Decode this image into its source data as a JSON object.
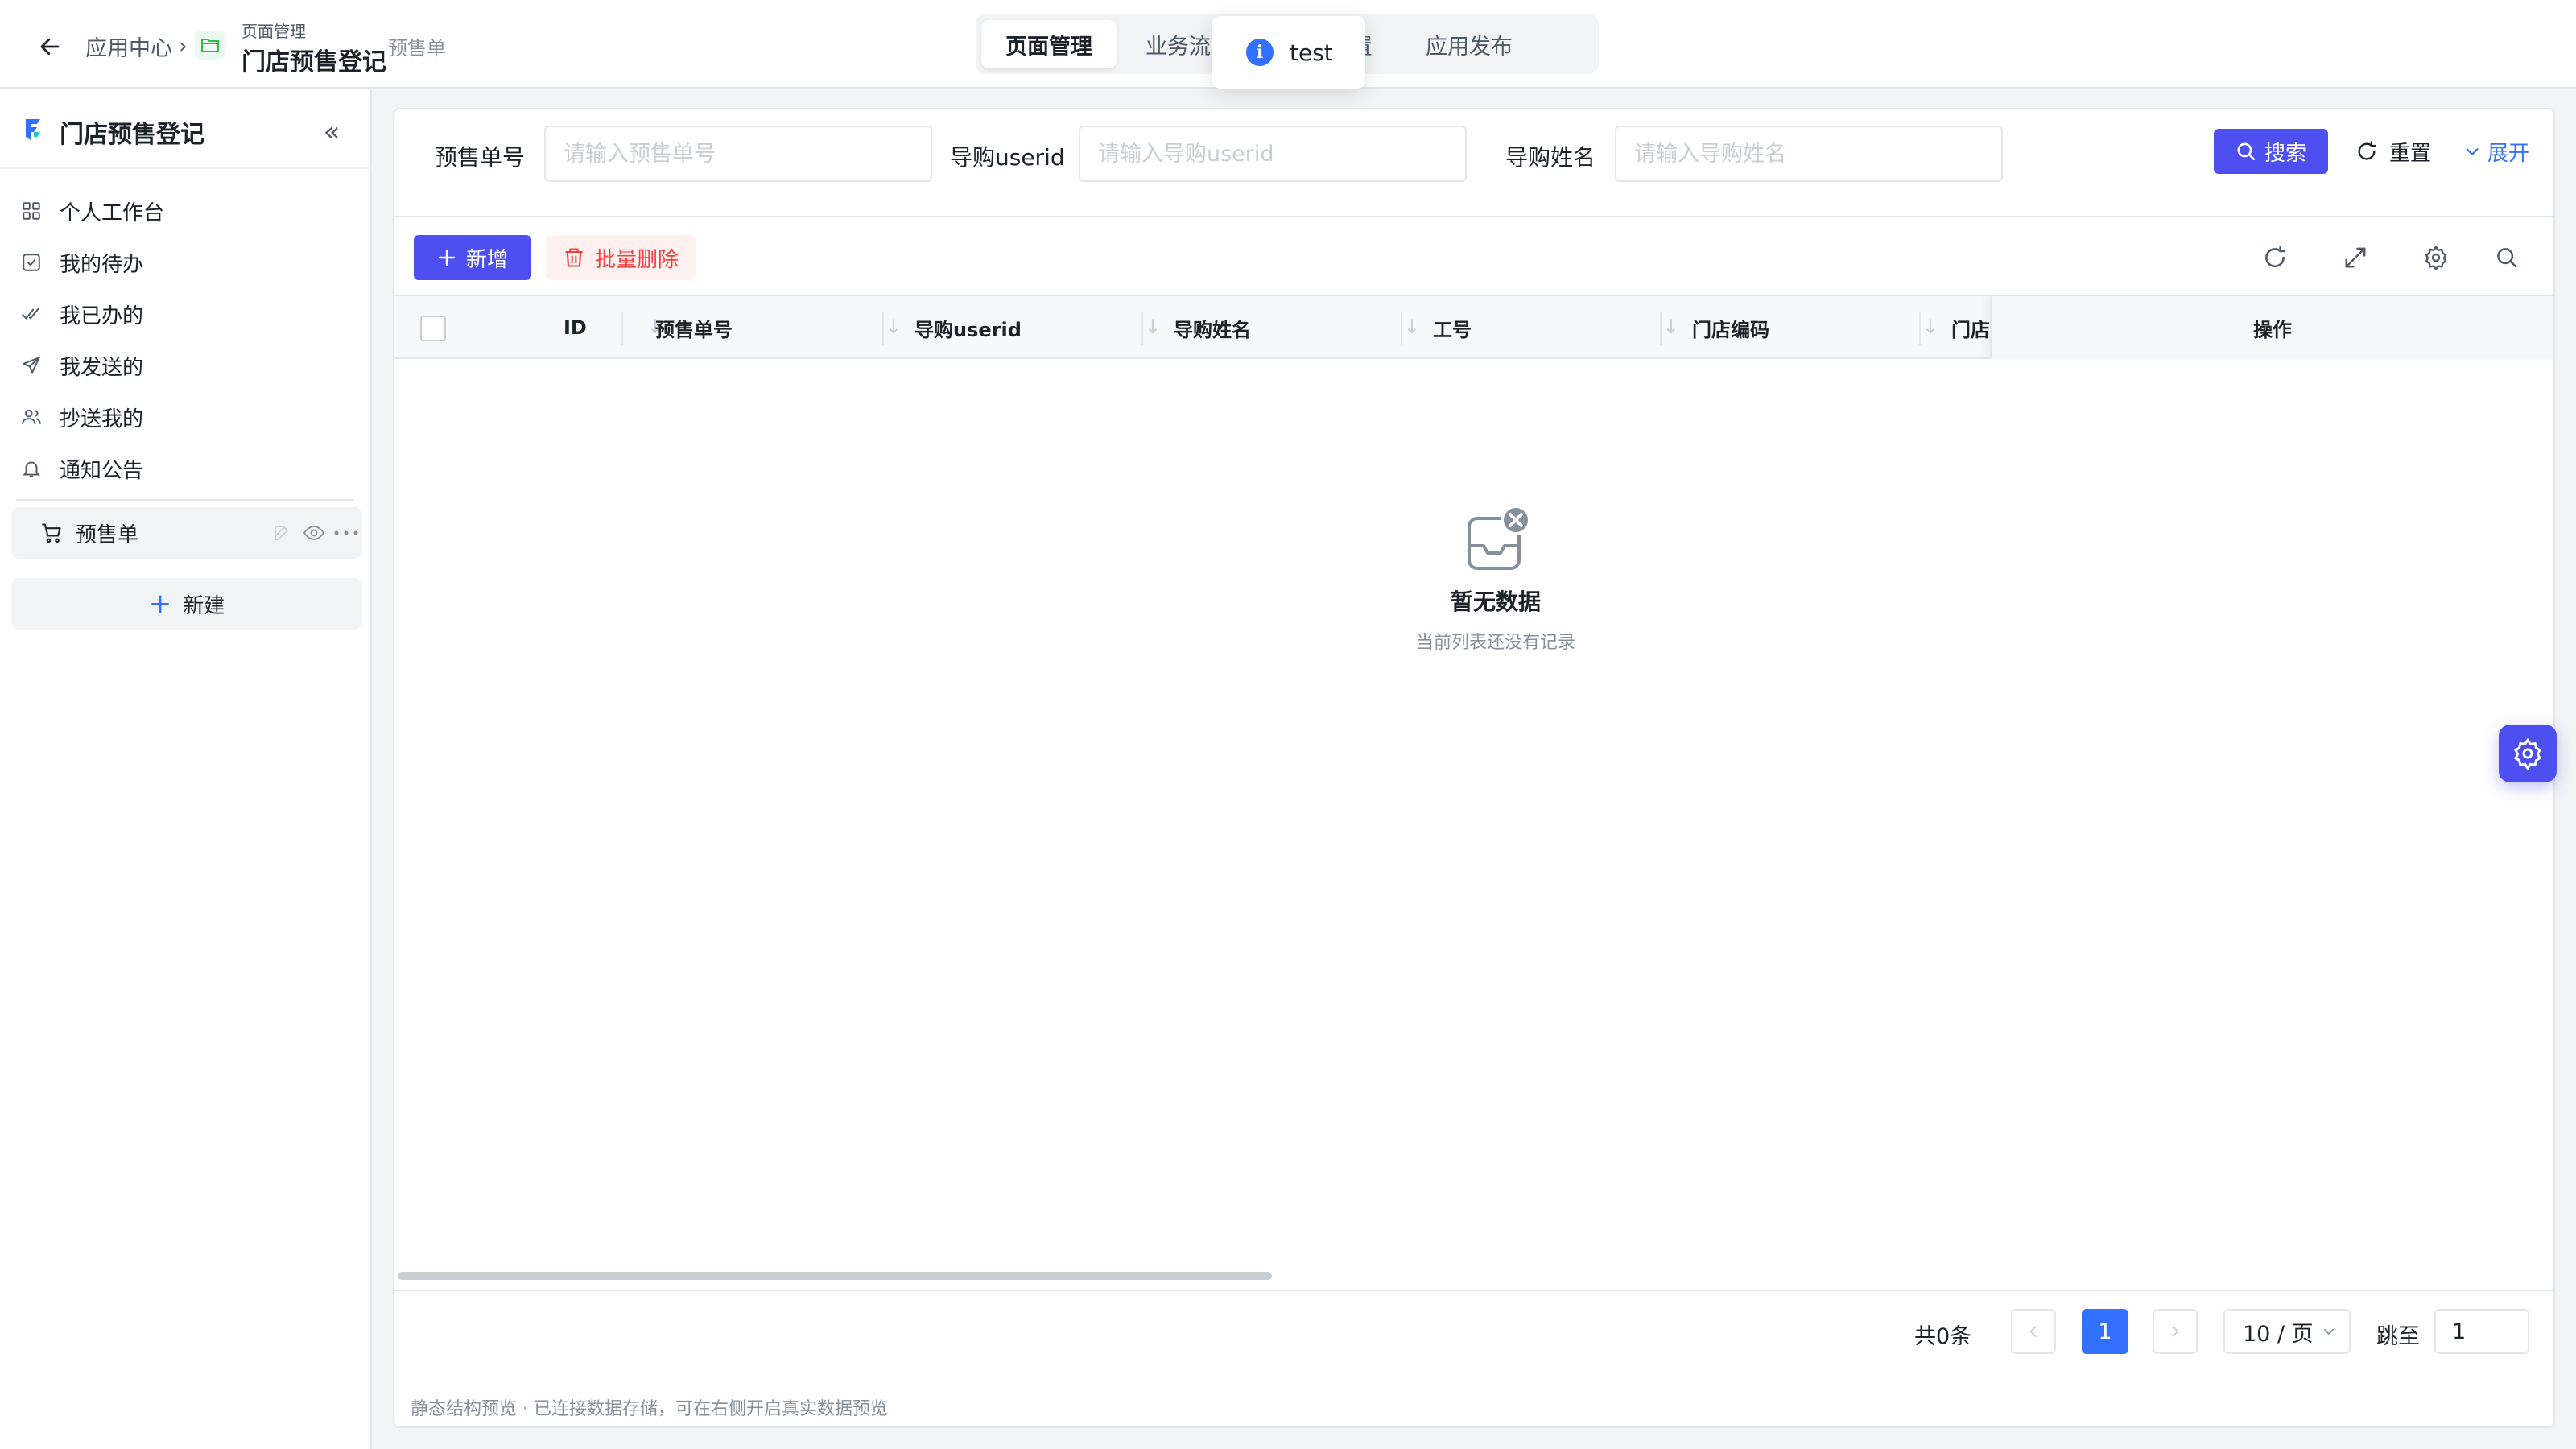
{
  "header": {
    "breadcrumb_root": "应用中心",
    "breadcrumb_sep": "›",
    "group_label": "页面管理",
    "app_title": "门店预售登记",
    "page_label": "预售单",
    "tabs": [
      {
        "label": "页面管理",
        "active": true
      },
      {
        "label": "业务流程",
        "active": false
      },
      {
        "label": "应用设置",
        "active": false
      },
      {
        "label": "应用发布",
        "active": false
      }
    ],
    "toast": {
      "icon": "info-icon",
      "text": "test"
    }
  },
  "sidebar": {
    "title": "门店预售登记",
    "collapse_label": "«",
    "items": [
      {
        "label": "个人工作台",
        "icon": "grid-icon"
      },
      {
        "label": "我的待办",
        "icon": "checkbox-icon"
      },
      {
        "label": "我已办的",
        "icon": "double-check-icon"
      },
      {
        "label": "我发送的",
        "icon": "send-icon"
      },
      {
        "label": "抄送我的",
        "icon": "users-icon"
      },
      {
        "label": "通知公告",
        "icon": "bell-icon"
      }
    ],
    "page": {
      "label": "预售单",
      "icon": "cart-icon"
    },
    "new_button": "新建"
  },
  "filters": [
    {
      "label": "预售单号",
      "placeholder": "请输入预售单号",
      "value": ""
    },
    {
      "label": "导购userid",
      "placeholder": "请输入导购userid",
      "value": ""
    },
    {
      "label": "导购姓名",
      "placeholder": "请输入导购姓名",
      "value": ""
    }
  ],
  "actions": {
    "search": "搜索",
    "reset": "重置",
    "expand": "展开",
    "add": "新增",
    "batch_delete": "批量删除"
  },
  "table": {
    "columns": [
      "ID",
      "预售单号",
      "导购userid",
      "导购姓名",
      "工号",
      "门店编码",
      "门店"
    ],
    "operation_column": "操作",
    "rows": [],
    "empty_title": "暂无数据",
    "empty_desc": "当前列表还没有记录"
  },
  "pagination": {
    "total_text": "共0条",
    "current_page": "1",
    "page_size": "10 / 页",
    "jump_label": "跳至",
    "jump_value": "1"
  },
  "footer_note": "静态结构预览 · 已连接数据存储，可在右侧开启真实数据预览",
  "colors": {
    "primary": "#4d4ff0",
    "link": "#3370ff",
    "danger": "#f53f3f",
    "border": "#e5e6eb"
  }
}
